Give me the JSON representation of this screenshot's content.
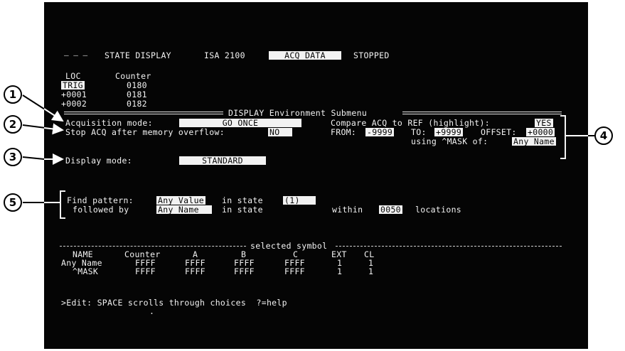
{
  "status_bar": {
    "dashes": "— — —",
    "mode": "STATE DISPLAY",
    "device": "ISA 2100",
    "acq_tab": "ACQ DATA",
    "run_state": "STOPPED"
  },
  "table_top": {
    "headers": [
      "LOC",
      "Counter"
    ],
    "rows": [
      {
        "loc": "TRIG",
        "counter": "0180"
      },
      {
        "loc": "+0001",
        "counter": "0181"
      },
      {
        "loc": "+0002",
        "counter": "0182"
      }
    ]
  },
  "submenu": {
    "title": "DISPLAY Environment Submenu",
    "acquisition_mode_label": "Acquisition mode:",
    "acquisition_mode_value": "GO ONCE",
    "stop_acq_label": "Stop ACQ after memory overflow:",
    "stop_acq_value": "NO",
    "compare_label": "Compare ACQ to REF (highlight):",
    "compare_value": "YES",
    "from_label": "FROM:",
    "from_value": "-9999",
    "to_label": "TO:",
    "to_value": "+9999",
    "offset_label": "OFFSET:",
    "offset_value": "+0000",
    "mask_label": "using ^MASK of:",
    "mask_value": "Any Name",
    "display_mode_label": "Display mode:",
    "display_mode_value": "STANDARD"
  },
  "find": {
    "find_label": "Find pattern:",
    "find_value": "Any Value",
    "in_state_1": "in state",
    "state_value": "(1)",
    "followed_label": "followed by",
    "followed_value": "Any Name",
    "in_state_2": "in state",
    "within_label": "within",
    "within_value": "0050",
    "locations_label": "locations"
  },
  "symbol_section": {
    "title": "selected symbol",
    "headers": [
      "NAME",
      "Counter",
      "A",
      "B",
      "C",
      "EXT",
      "CL"
    ],
    "rows": [
      [
        "Any Name",
        "FFFF",
        "FFFF",
        "FFFF",
        "FFFF",
        "1",
        "1"
      ],
      [
        "^MASK",
        "FFFF",
        "FFFF",
        "FFFF",
        "FFFF",
        "1",
        "1"
      ]
    ]
  },
  "prompt": ">Edit: SPACE scrolls through choices  ?=help",
  "callouts": [
    "1",
    "2",
    "3",
    "4",
    "5"
  ],
  "colors": {
    "screen": "#050505",
    "text": "#f2f2f2",
    "page": "#ffffff"
  }
}
